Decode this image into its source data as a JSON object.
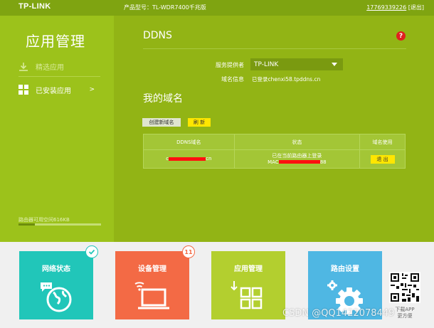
{
  "header": {
    "logo": "TP-LINK",
    "model": "产品型号：TL-WDR7400千兆版",
    "user_phone": "17769339226",
    "logout": "[退出]"
  },
  "sidebar": {
    "title": "应用管理",
    "items": [
      {
        "label": "精选应用",
        "icon": "download-icon",
        "state": "inactive"
      },
      {
        "label": "已安装应用",
        "icon": "grid-icon",
        "state": "active",
        "chevron": ">"
      }
    ],
    "storage_label": "路由器可用空间616KB",
    "storage_used_fraction": 0.2
  },
  "main": {
    "title": "DDNS",
    "help": "?",
    "provider_label": "服务提供者",
    "provider_value": "TP-LINK",
    "domain_info_label": "域名信息",
    "domain_info_value": "已登录chenxi58.tpddns.cn",
    "my_domain_title": "我的域名",
    "create_button": "创建新域名",
    "refresh_button": "刷 新",
    "table": {
      "headers": [
        "DDNS域名",
        "状态",
        "域名使用"
      ],
      "rows": [
        {
          "domain_prefix": "c",
          "domain_suffix": "cn",
          "status_line1": "已在当前路由器上登录",
          "status_line2_prefix": "MAC",
          "status_line2_suffix": "88",
          "action": "退 出"
        }
      ]
    }
  },
  "bottom": {
    "tiles": [
      {
        "label": "网络状态",
        "color": "#21c6b9",
        "icon": "globe-icon",
        "badge": "check"
      },
      {
        "label": "设备管理",
        "color": "#f36a45",
        "icon": "laptop-wifi-icon",
        "badge": "11"
      },
      {
        "label": "应用管理",
        "color": "#b3cf2f",
        "icon": "apps-grid-icon"
      },
      {
        "label": "路由设置",
        "color": "#4fb7e3",
        "icon": "gear-icon"
      }
    ],
    "qr_text1": "下载APP",
    "qr_text2": "更方便",
    "watermark": "CSDN @QQ1422078449"
  }
}
